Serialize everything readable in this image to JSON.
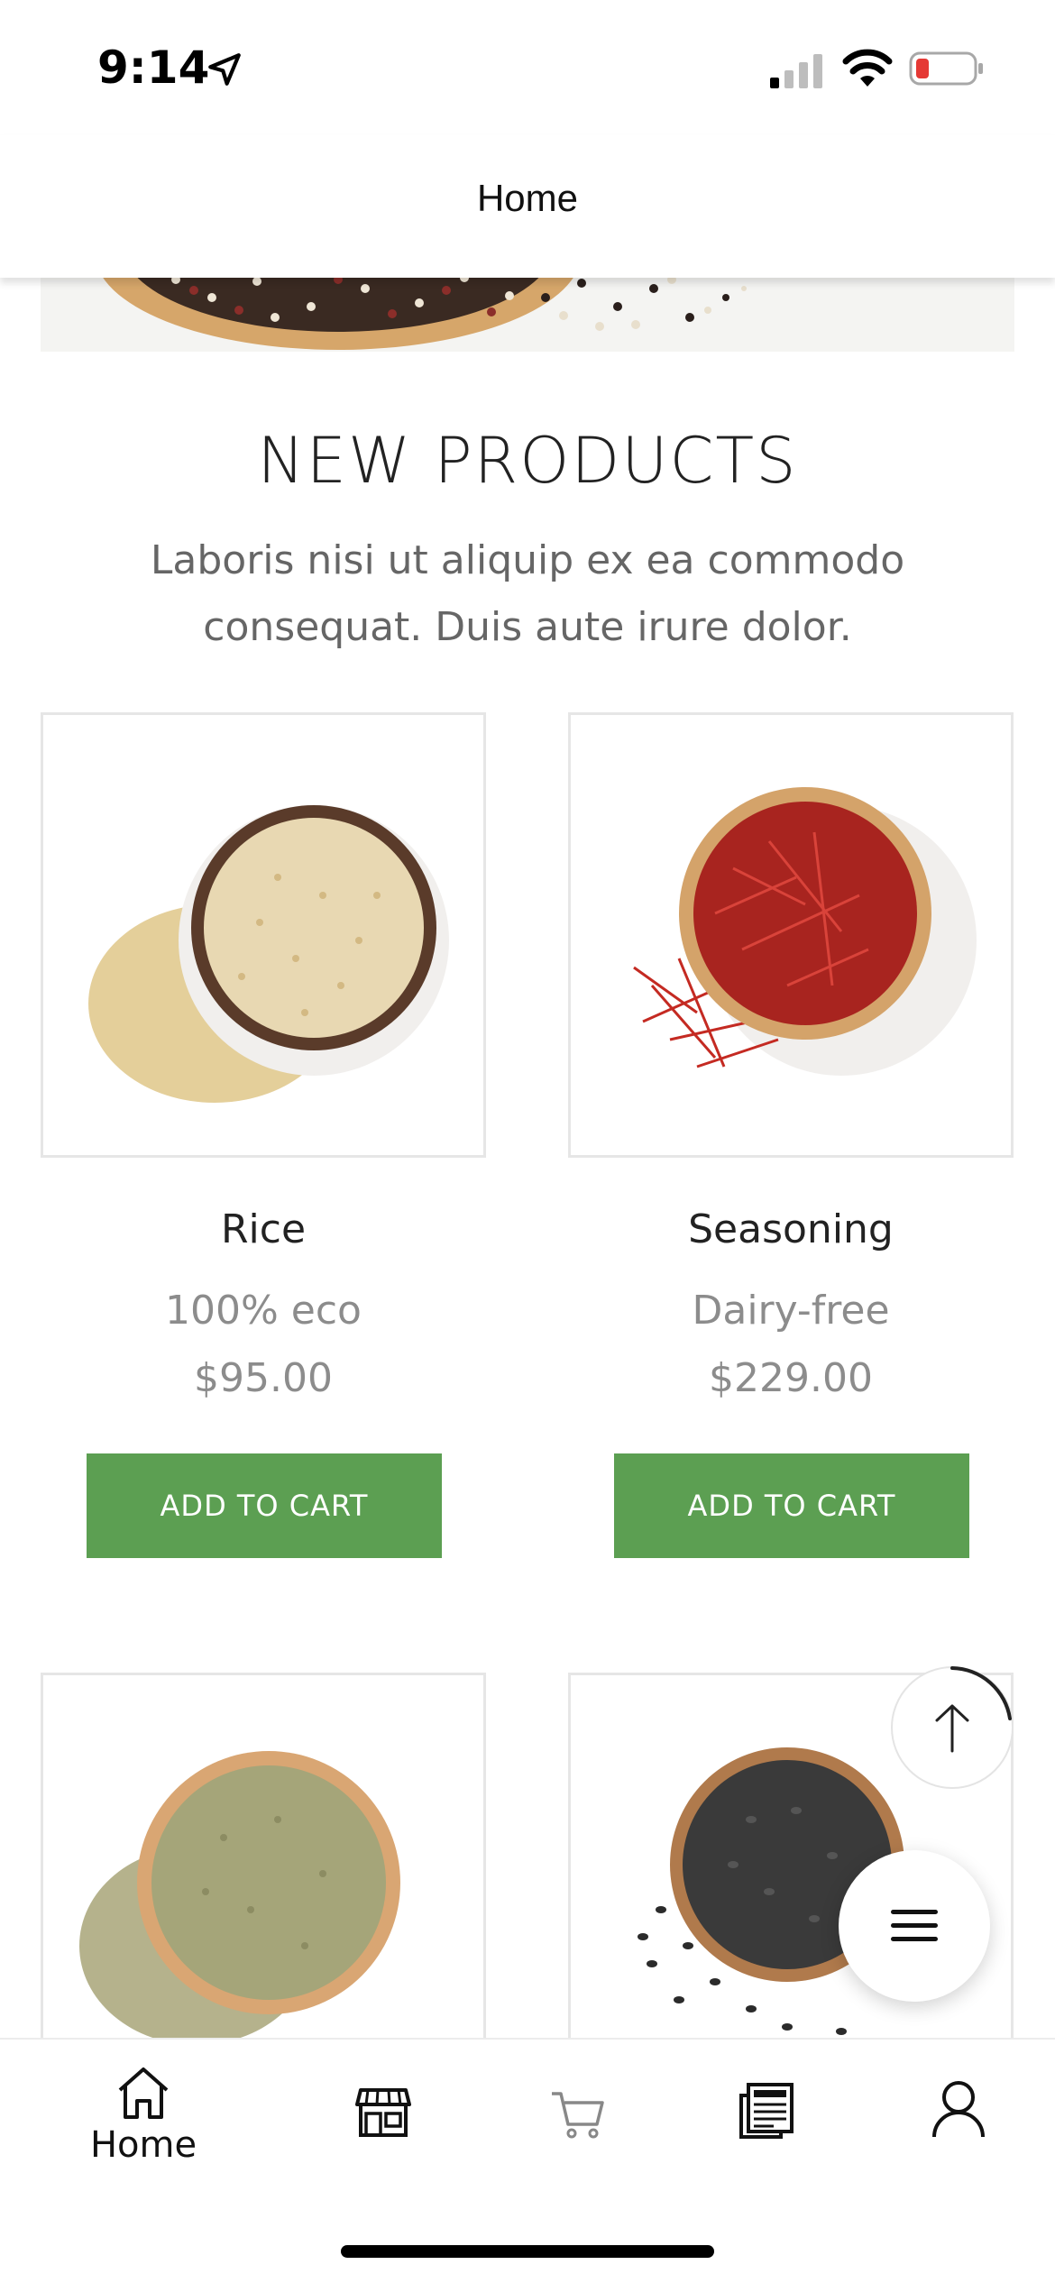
{
  "status_bar": {
    "time": "9:14",
    "icons": [
      "location-arrow-icon",
      "cellular-signal-icon",
      "wifi-icon",
      "battery-low-icon"
    ],
    "battery_color": "#e53935"
  },
  "header": {
    "title": "Home"
  },
  "section": {
    "title": "NEW PRODUCTS",
    "subtitle": "Laboris nisi ut aliquip ex ea commodo consequat. Duis aute irure dolor."
  },
  "products": [
    {
      "name": "Rice",
      "tag": "100% eco",
      "price": "$95.00",
      "button": "ADD TO CART"
    },
    {
      "name": "Seasoning",
      "tag": "Dairy-free",
      "price": "$229.00",
      "button": "ADD TO CART"
    }
  ],
  "colors": {
    "accent": "#5c9f52",
    "text_muted": "#8c8c8c"
  },
  "tab_bar": {
    "tabs": [
      {
        "icon": "home-icon",
        "label": "Home",
        "active": true
      },
      {
        "icon": "store-icon",
        "label": ""
      },
      {
        "icon": "cart-icon",
        "label": ""
      },
      {
        "icon": "news-icon",
        "label": ""
      },
      {
        "icon": "user-icon",
        "label": ""
      }
    ]
  },
  "floating": {
    "scroll_top_icon": "arrow-up-icon",
    "menu_icon": "hamburger-menu-icon"
  }
}
